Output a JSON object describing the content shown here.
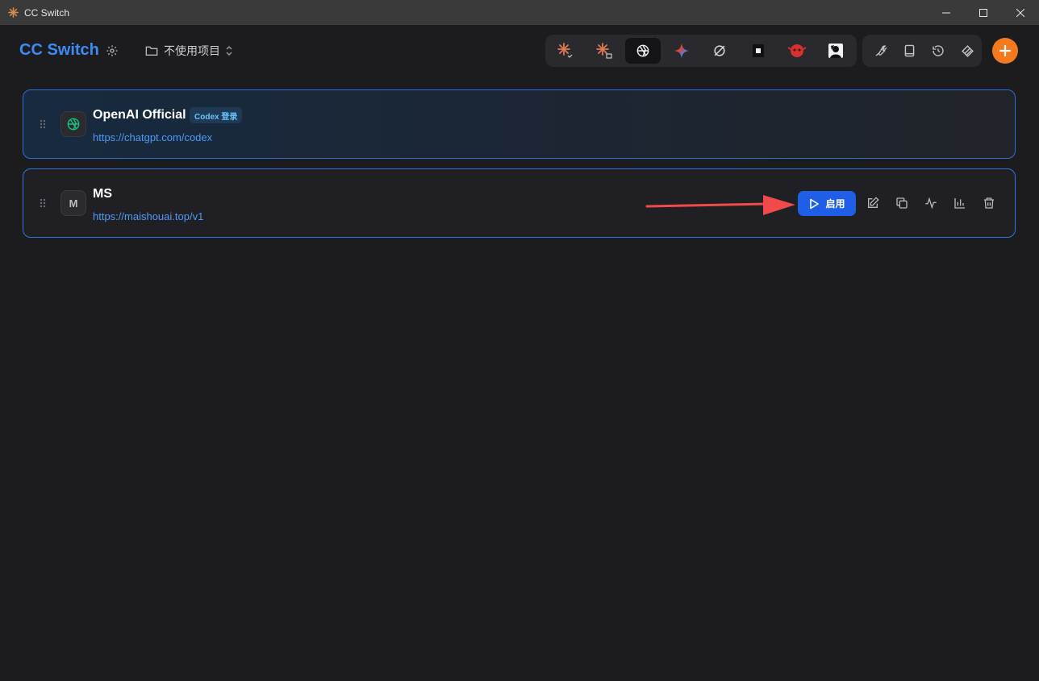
{
  "window": {
    "title": "CC Switch"
  },
  "header": {
    "brand": "CC Switch",
    "project_select": "不使用项目",
    "app_tabs": [
      {
        "icon": "claude-code-icon",
        "active": false
      },
      {
        "icon": "claude-desktop-icon",
        "active": false
      },
      {
        "icon": "openai-icon",
        "active": true
      },
      {
        "icon": "gemini-icon",
        "active": false
      },
      {
        "icon": "opencode-icon",
        "active": false
      },
      {
        "icon": "terminal-square-icon",
        "active": false
      },
      {
        "icon": "red-mascot-icon",
        "active": false
      },
      {
        "icon": "avatar-app-icon",
        "active": false
      }
    ],
    "tools": [
      "wrench-icon",
      "book-icon",
      "history-icon",
      "layers-icon"
    ]
  },
  "providers": [
    {
      "name": "OpenAI Official",
      "badge": "Codex 登录",
      "url": "https://chatgpt.com/codex",
      "icon": "openai-icon",
      "current": true
    },
    {
      "name": "MS",
      "initial": "M",
      "url": "https://maishouai.top/v1",
      "current": false,
      "enable_label": "启用"
    }
  ],
  "colors": {
    "accent": "#3b8cf5",
    "enable": "#1f5ee6",
    "add": "#f57a1f",
    "arrow": "#f04a4a"
  }
}
